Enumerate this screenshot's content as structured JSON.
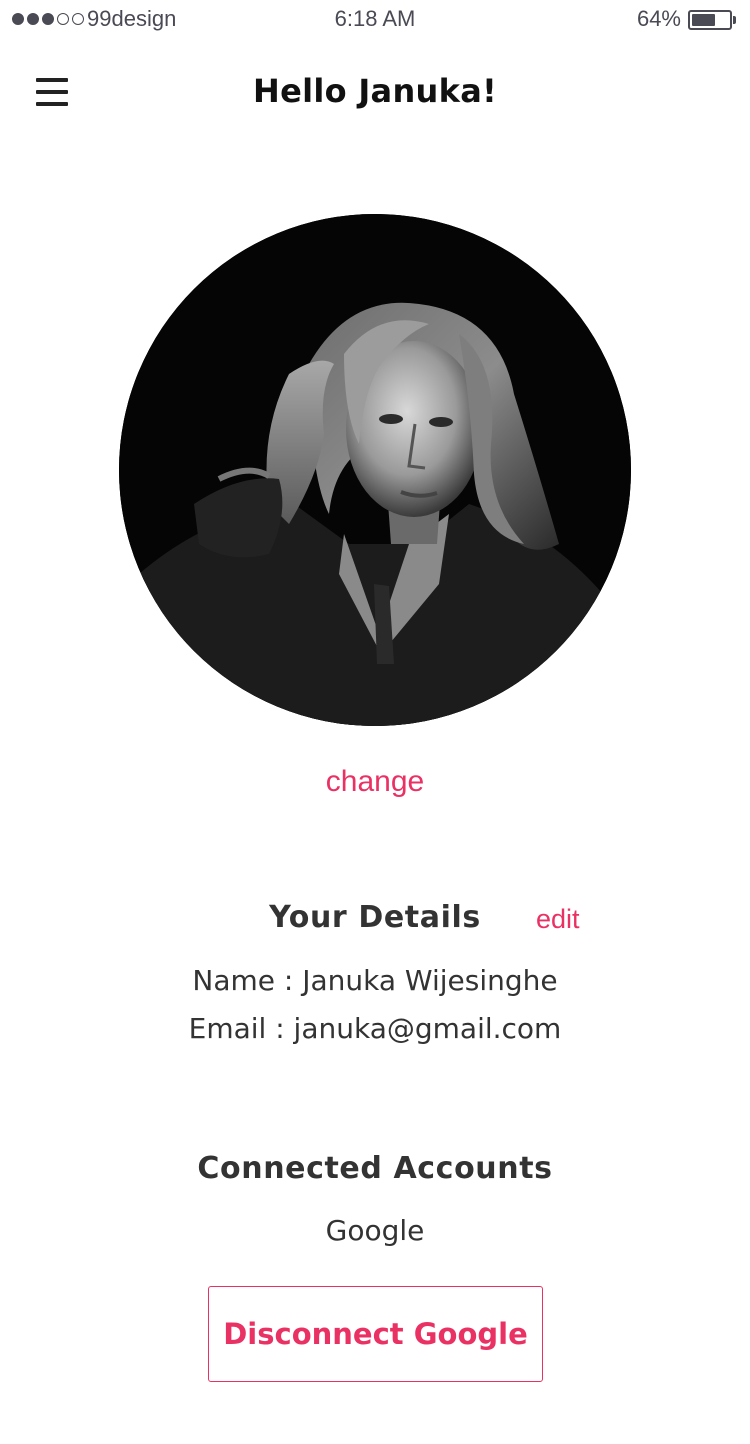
{
  "status_bar": {
    "carrier": "99design",
    "signal_bars_filled": 3,
    "signal_bars_total": 5,
    "time": "6:18 AM",
    "battery_percent_label": "64%",
    "battery_level": 0.64
  },
  "header": {
    "title": "Hello Januka!",
    "menu_icon": "hamburger-menu-icon"
  },
  "profile": {
    "avatar_description": "black-and-white portrait photo",
    "change_label": "change"
  },
  "details": {
    "title": "Your Details",
    "edit_label": "edit",
    "name_line": "Name : Januka Wijesinghe",
    "email_line": "Email : januka@gmail.com"
  },
  "accounts": {
    "title": "Connected Accounts",
    "account": "Google",
    "disconnect_label": "Disconnect Google"
  },
  "colors": {
    "accent": "#ea3163",
    "text": "#333333",
    "status": "#4a4a55"
  }
}
